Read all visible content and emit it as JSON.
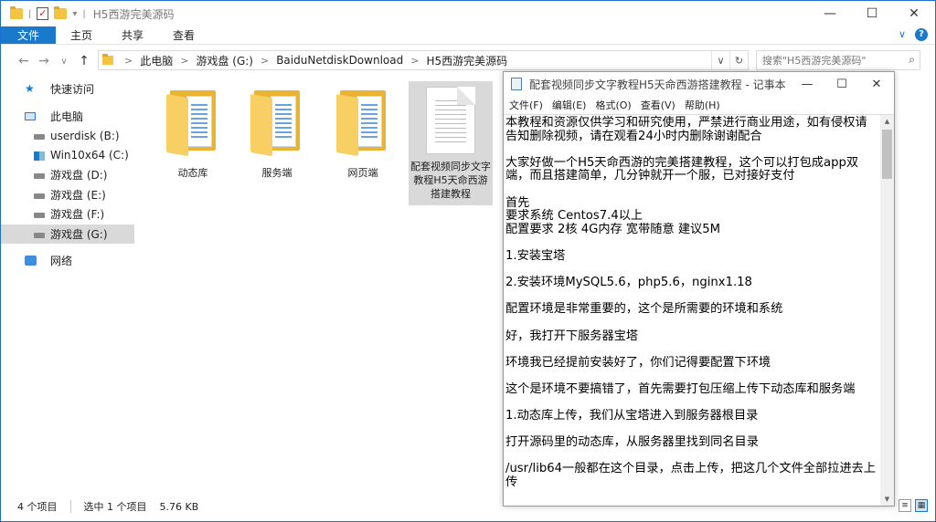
{
  "explorer": {
    "title": "H5西游完美源码",
    "window_controls": {
      "minimize": "—",
      "maximize": "☐",
      "close": "✕"
    },
    "ribbon": {
      "tabs": [
        "文件",
        "主页",
        "共享",
        "查看"
      ],
      "collapse": "∨",
      "help": "?"
    },
    "nav": {
      "back": "←",
      "forward": "→",
      "recent": "∨",
      "up": "↑",
      "breadcrumbs": [
        "此电脑",
        "游戏盘 (G:)",
        "BaiduNetdiskDownload",
        "H5西游完美源码"
      ],
      "separator": ">",
      "dropdown": "∨",
      "refresh": "↻"
    },
    "search": {
      "placeholder": "搜索\"H5西游完美源码\"",
      "icon": "search-icon"
    },
    "sidebar": {
      "quick_access": "快速访问",
      "this_pc": "此电脑",
      "drives": [
        "userdisk (B:)",
        "Win10x64 (C:)",
        "游戏盘 (D:)",
        "游戏盘 (E:)",
        "游戏盘 (F:)",
        "游戏盘 (G:)"
      ],
      "selected_drive": "游戏盘 (G:)",
      "network": "网络"
    },
    "files": [
      {
        "name": "动态库",
        "type": "folder"
      },
      {
        "name": "服务端",
        "type": "folder"
      },
      {
        "name": "网页端",
        "type": "folder"
      },
      {
        "name": "配套视频同步文字教程H5天命西游搭建教程",
        "type": "text-document",
        "selected": true
      }
    ],
    "status": {
      "item_count": "4 个项目",
      "selection": "选中 1 个项目",
      "size": "5.76 KB"
    }
  },
  "notepad": {
    "title": "配套视频同步文字教程H5天命西游搭建教程 - 记事本",
    "window_controls": {
      "minimize": "—",
      "maximize": "☐",
      "close": "✕"
    },
    "menu": [
      "文件(F)",
      "编辑(E)",
      "格式(O)",
      "查看(V)",
      "帮助(H)"
    ],
    "scroll_up": "▲",
    "scroll_down": "▼",
    "content": "本教程和资源仅供学习和研究使用，严禁进行商业用途，如有侵权请告知删除视频，请在观看24小时内删除谢谢配合\n\n大家好做一个H5天命西游的完美搭建教程，这个可以打包成app双端，而且搭建简单，几分钟就开一个服，已对接好支付\n\n首先\n要求系统 Centos7.4以上\n配置要求 2核 4G内存 宽带随意 建议5M\n\n1.安装宝塔\n\n2.安装环境MySQL5.6，php5.6，nginx1.18\n\n配置环境是非常重要的，这个是所需要的环境和系统\n\n好，我打开下服务器宝塔\n\n环境我已经提前安装好了，你们记得要配置下环境\n\n这个是环境不要搞错了，首先需要打包压缩上传下动态库和服务端\n\n1.动态库上传，我们从宝塔进入到服务器根目录\n\n打开源码里的动态库，从服务器里找到同名目录\n\n/usr/lib64一般都在这个目录，点击上传，把这几个文件全部拉进去上传"
  }
}
